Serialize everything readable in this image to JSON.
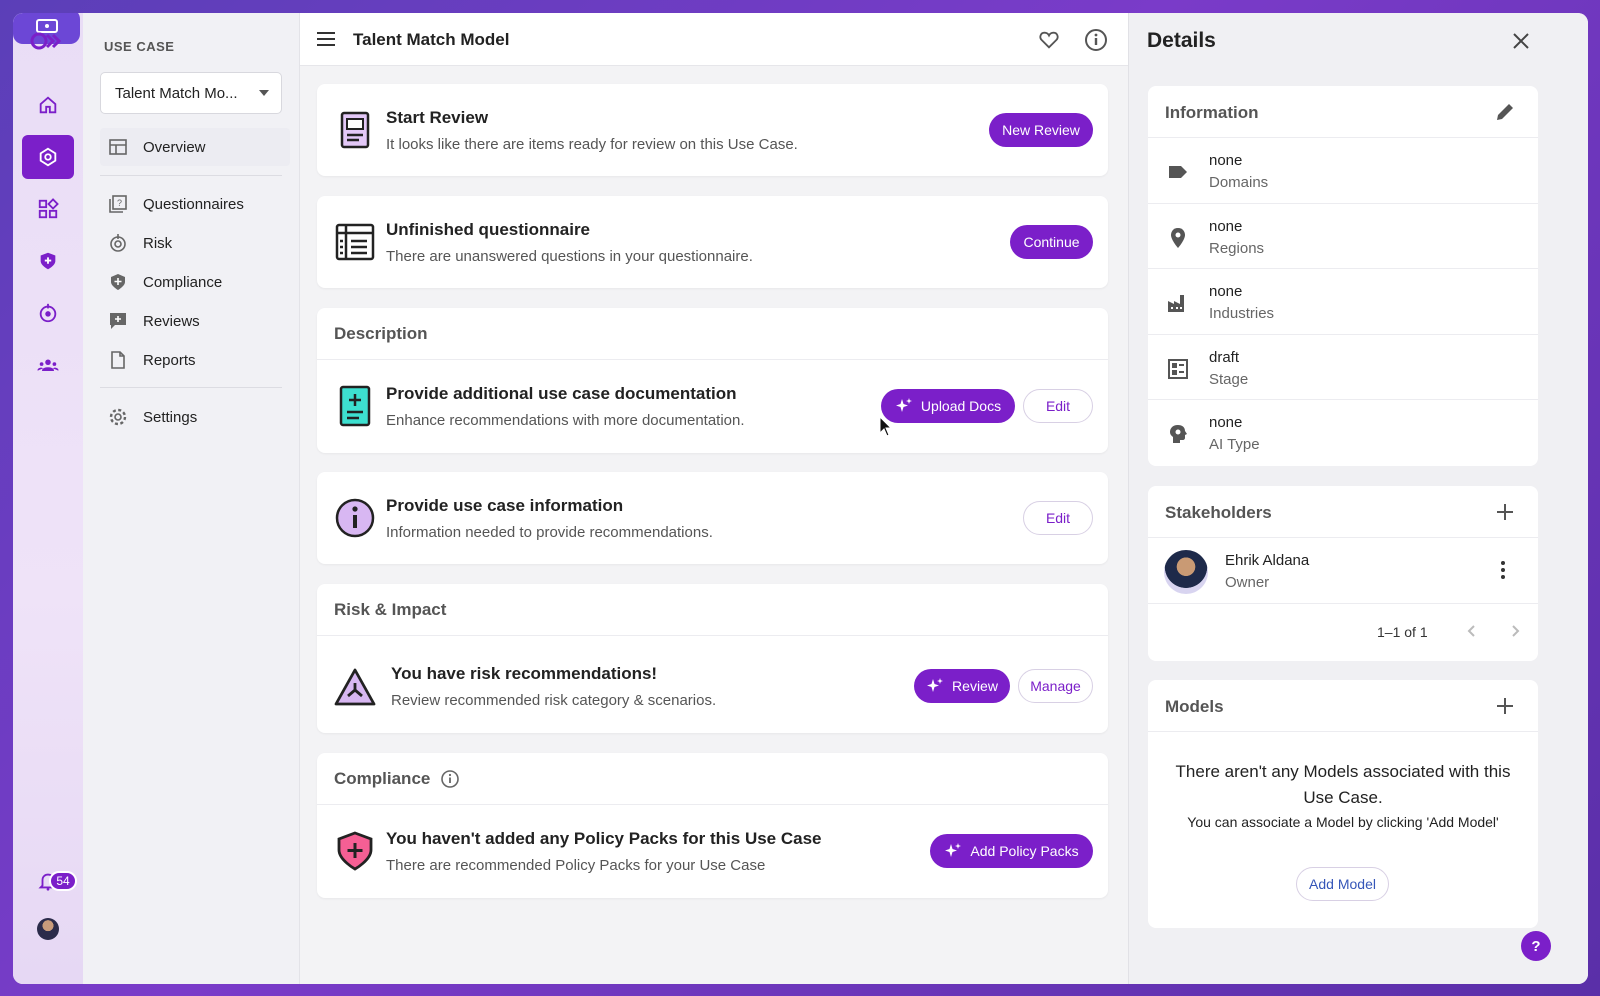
{
  "rail": {
    "notification_count": "54"
  },
  "subnav": {
    "section_label": "USE CASE",
    "selected_use_case": "Talent Match Mo...",
    "items": [
      {
        "label": "Overview"
      },
      {
        "label": "Questionnaires"
      },
      {
        "label": "Risk"
      },
      {
        "label": "Compliance"
      },
      {
        "label": "Reviews"
      },
      {
        "label": "Reports"
      },
      {
        "label": "Settings"
      }
    ]
  },
  "header": {
    "title": "Talent Match Model"
  },
  "cards": {
    "start_review": {
      "title": "Start Review",
      "subtitle": "It looks like there are items ready for review on this Use Case.",
      "button": "New Review"
    },
    "questionnaire": {
      "title": "Unfinished questionnaire",
      "subtitle": "There are unanswered questions in your questionnaire.",
      "button": "Continue"
    },
    "description": {
      "heading": "Description",
      "docs_title": "Provide additional use case documentation",
      "docs_subtitle": "Enhance recommendations with more documentation.",
      "upload_button": "Upload Docs",
      "edit_button": "Edit"
    },
    "info": {
      "title": "Provide use case information",
      "subtitle": "Information needed to provide recommendations.",
      "edit_button": "Edit"
    },
    "risk": {
      "heading": "Risk & Impact",
      "title": "You have risk recommendations!",
      "subtitle": "Review recommended risk category & scenarios.",
      "review_button": "Review",
      "manage_button": "Manage"
    },
    "compliance": {
      "heading": "Compliance",
      "title": "You haven't added any Policy Packs for this Use Case",
      "subtitle": "There are recommended Policy Packs for your Use Case",
      "button": "Add Policy Packs"
    }
  },
  "details": {
    "title": "Details",
    "information": {
      "heading": "Information",
      "rows": [
        {
          "value": "none",
          "label": "Domains",
          "icon": "tag-icon"
        },
        {
          "value": "none",
          "label": "Regions",
          "icon": "location-pin-icon"
        },
        {
          "value": "none",
          "label": "Industries",
          "icon": "factory-icon"
        },
        {
          "value": "draft",
          "label": "Stage",
          "icon": "stage-icon"
        },
        {
          "value": "none",
          "label": "AI Type",
          "icon": "brain-icon"
        }
      ]
    },
    "stakeholders": {
      "heading": "Stakeholders",
      "name": "Ehrik Aldana",
      "role": "Owner",
      "pagination": "1–1 of 1"
    },
    "models": {
      "heading": "Models",
      "empty_title": "There aren't any Models associated with this Use Case.",
      "empty_hint": "You can associate a Model by clicking 'Add Model'",
      "button": "Add Model"
    }
  },
  "help_label": "?",
  "colors": {
    "accent": "#7b1fc9",
    "rail_bg": "#e9ddf6"
  }
}
